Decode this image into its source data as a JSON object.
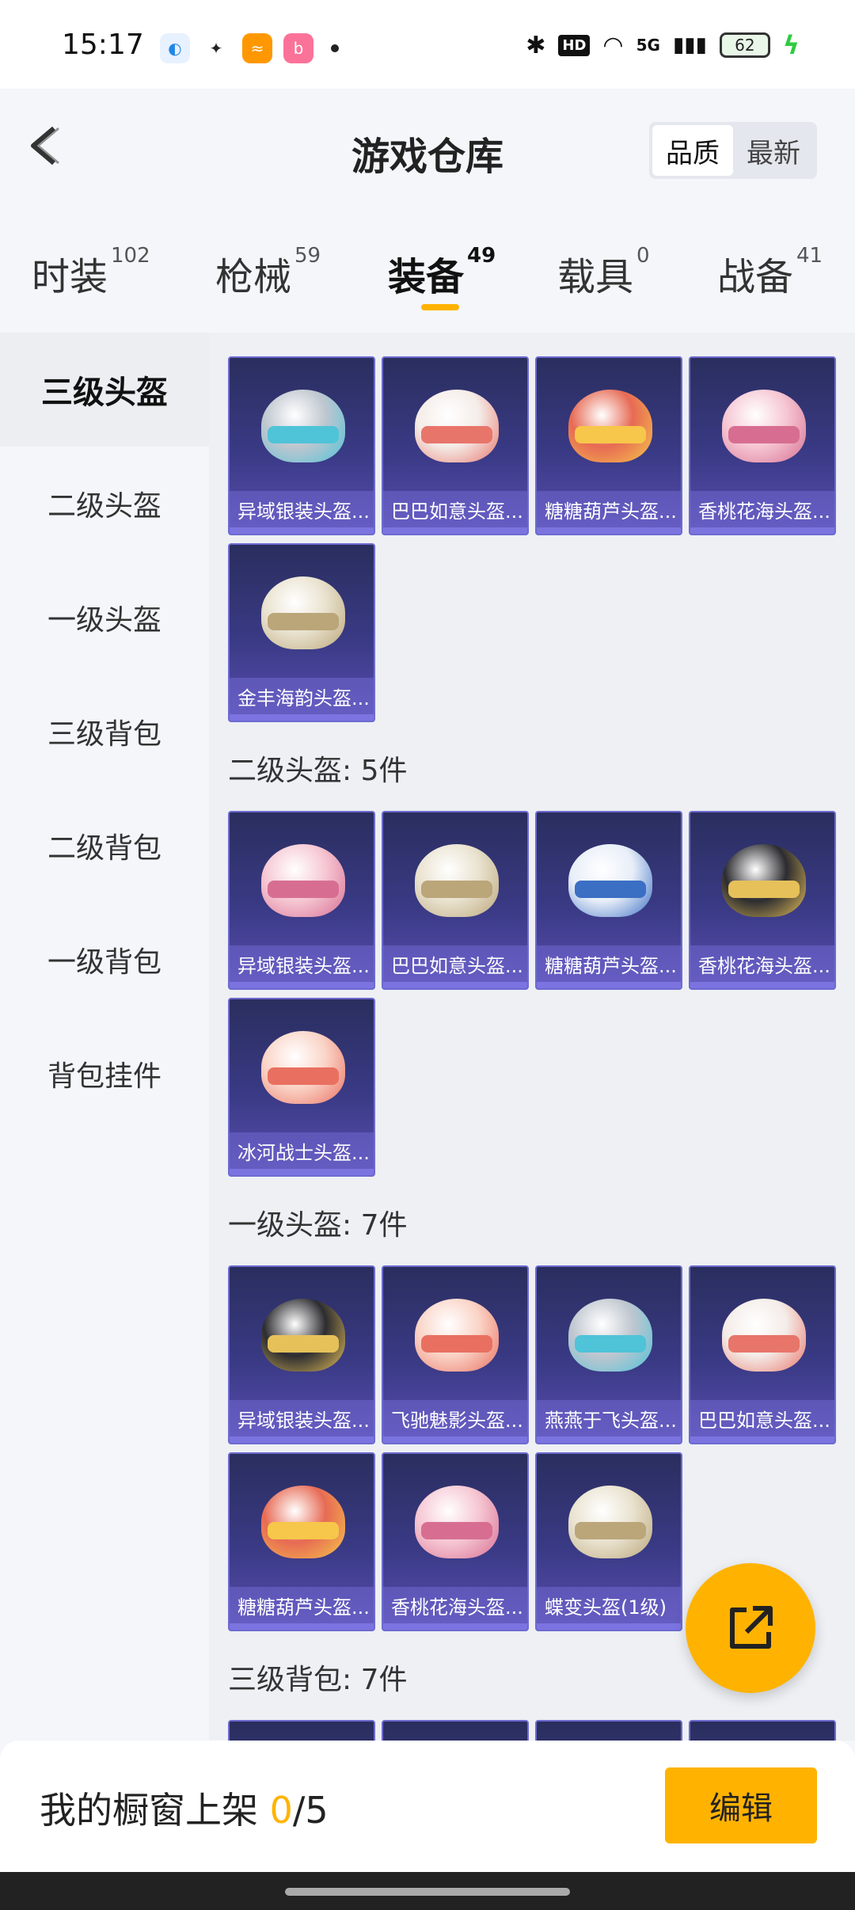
{
  "status_bar": {
    "time": "15:17",
    "apps": [
      "qq-icon",
      "wechat-icon",
      "app-icon",
      "bilibili-icon"
    ],
    "hd_label": "HD",
    "network_label": "5G",
    "battery": "62"
  },
  "header": {
    "title": "游戏仓库",
    "sort_options": [
      "品质",
      "最新"
    ],
    "selected_sort": "品质"
  },
  "tabs": [
    {
      "label": "时装",
      "count": "102"
    },
    {
      "label": "枪械",
      "count": "59"
    },
    {
      "label": "装备",
      "count": "49"
    },
    {
      "label": "载具",
      "count": "0"
    },
    {
      "label": "战备",
      "count": "41"
    }
  ],
  "active_tab": "装备",
  "sidebar": {
    "items": [
      "三级头盔",
      "二级头盔",
      "一级头盔",
      "三级背包",
      "二级背包",
      "一级背包",
      "背包挂件"
    ],
    "active": "三级头盔"
  },
  "sections": [
    {
      "title": "",
      "items": [
        "异域银装头盔...",
        "巴巴如意头盔...",
        "糖糖葫芦头盔...",
        "香桃花海头盔...",
        "金丰海韵头盔..."
      ]
    },
    {
      "title": "二级头盔: 5件",
      "items": [
        "异域银装头盔...",
        "巴巴如意头盔...",
        "糖糖葫芦头盔...",
        "香桃花海头盔...",
        "冰河战士头盔..."
      ]
    },
    {
      "title": "一级头盔: 7件",
      "items": [
        "异域银装头盔...",
        "飞驰魅影头盔...",
        "燕燕于飞头盔...",
        "巴巴如意头盔...",
        "糖糖葫芦头盔...",
        "香桃花海头盔...",
        "蝶变头盔(1级)"
      ]
    },
    {
      "title": "三级背包: 7件",
      "items": []
    }
  ],
  "colors": {
    "accent": "#ffb300",
    "card_bg": "#3a3a86"
  },
  "bottom_bar": {
    "label": "我的橱窗上架",
    "count": "0",
    "total": "/5",
    "edit_button": "编辑"
  }
}
